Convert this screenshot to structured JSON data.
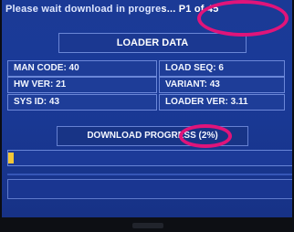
{
  "status": {
    "message": "Please wait download in progre",
    "ellipsis": "s... P1 of 45"
  },
  "title": "LOADER DATA",
  "fields": {
    "man_code": "MAN CODE: 40",
    "load_seq": "LOAD SEQ: 6",
    "hw_ver": "HW VER: 21",
    "variant": "VARIANT: 43",
    "sys_id": "SYS ID: 43",
    "loader_ver": "LOADER VER: 3.11"
  },
  "progress": {
    "label": "DOWNLOAD PROGRESS",
    "percent_text": "(2%)",
    "fraction": 0.02
  },
  "colors": {
    "screen": "#1b3a96",
    "bar_fill": "#f3c637",
    "highlight_circle": "#e0147a"
  }
}
